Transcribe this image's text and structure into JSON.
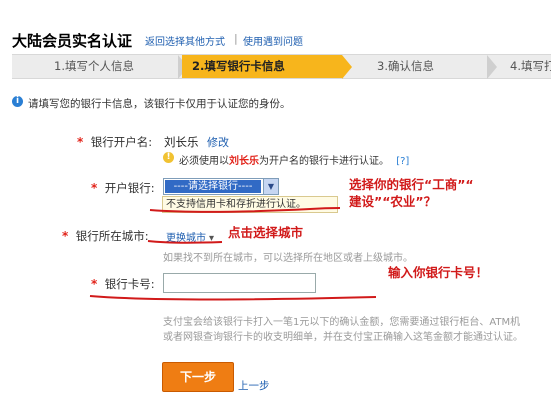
{
  "header": {
    "title": "大陆会员实名认证",
    "link_other": "返回选择其他方式",
    "separator": "|",
    "link_help": "使用遇到问题"
  },
  "steps": [
    {
      "label": "1.填写个人信息"
    },
    {
      "label": "2.填写银行卡信息"
    },
    {
      "label": "3.确认信息"
    },
    {
      "label": "4.填写打"
    }
  ],
  "info": {
    "icon": "i",
    "text": "请填写您的银行卡信息，该银行卡仅用于认证您的身份。"
  },
  "form": {
    "holder": {
      "star": "*",
      "label": "银行开户名:",
      "value": "刘长乐",
      "edit": "修改",
      "tip_icon": "!",
      "tip_pre": "必须使用以",
      "tip_name": "刘长乐",
      "tip_post": "为开户名的银行卡进行认证。",
      "tip_help": "[?]"
    },
    "bank": {
      "star": "*",
      "label": "开户银行:",
      "select_value": "----请选择银行----",
      "select_arrow": "▼",
      "warning": "不支持信用卡和存折进行认证。"
    },
    "city": {
      "star": "*",
      "label": "银行所在城市:",
      "link": "更换城市",
      "arrow": "▾",
      "hint": "如果找不到所在城市，可以选择所在地区或者上级城市。"
    },
    "card": {
      "star": "*",
      "label": "银行卡号:",
      "value": "",
      "note_line1": "支付宝会给该银行卡打入一笔1元以下的确认金额，您需要通过银行柜台、ATM机",
      "note_line2": "或者网银查询银行卡的收支明细单，并在支付宝正确输入这笔金额才能通过认证。"
    }
  },
  "buttons": {
    "next": "下一步",
    "prev": "上一步"
  },
  "annotations": {
    "bank_line1": "选择你的银行“工商”“",
    "bank_line2": "建设”“农业”？",
    "city": "点击选择城市",
    "card": "输入你银行卡号！"
  },
  "colors": {
    "accent": "#f7b51c",
    "link": "#1f5fb0",
    "annotation": "#d11a1a",
    "button": "#ef7d13"
  }
}
